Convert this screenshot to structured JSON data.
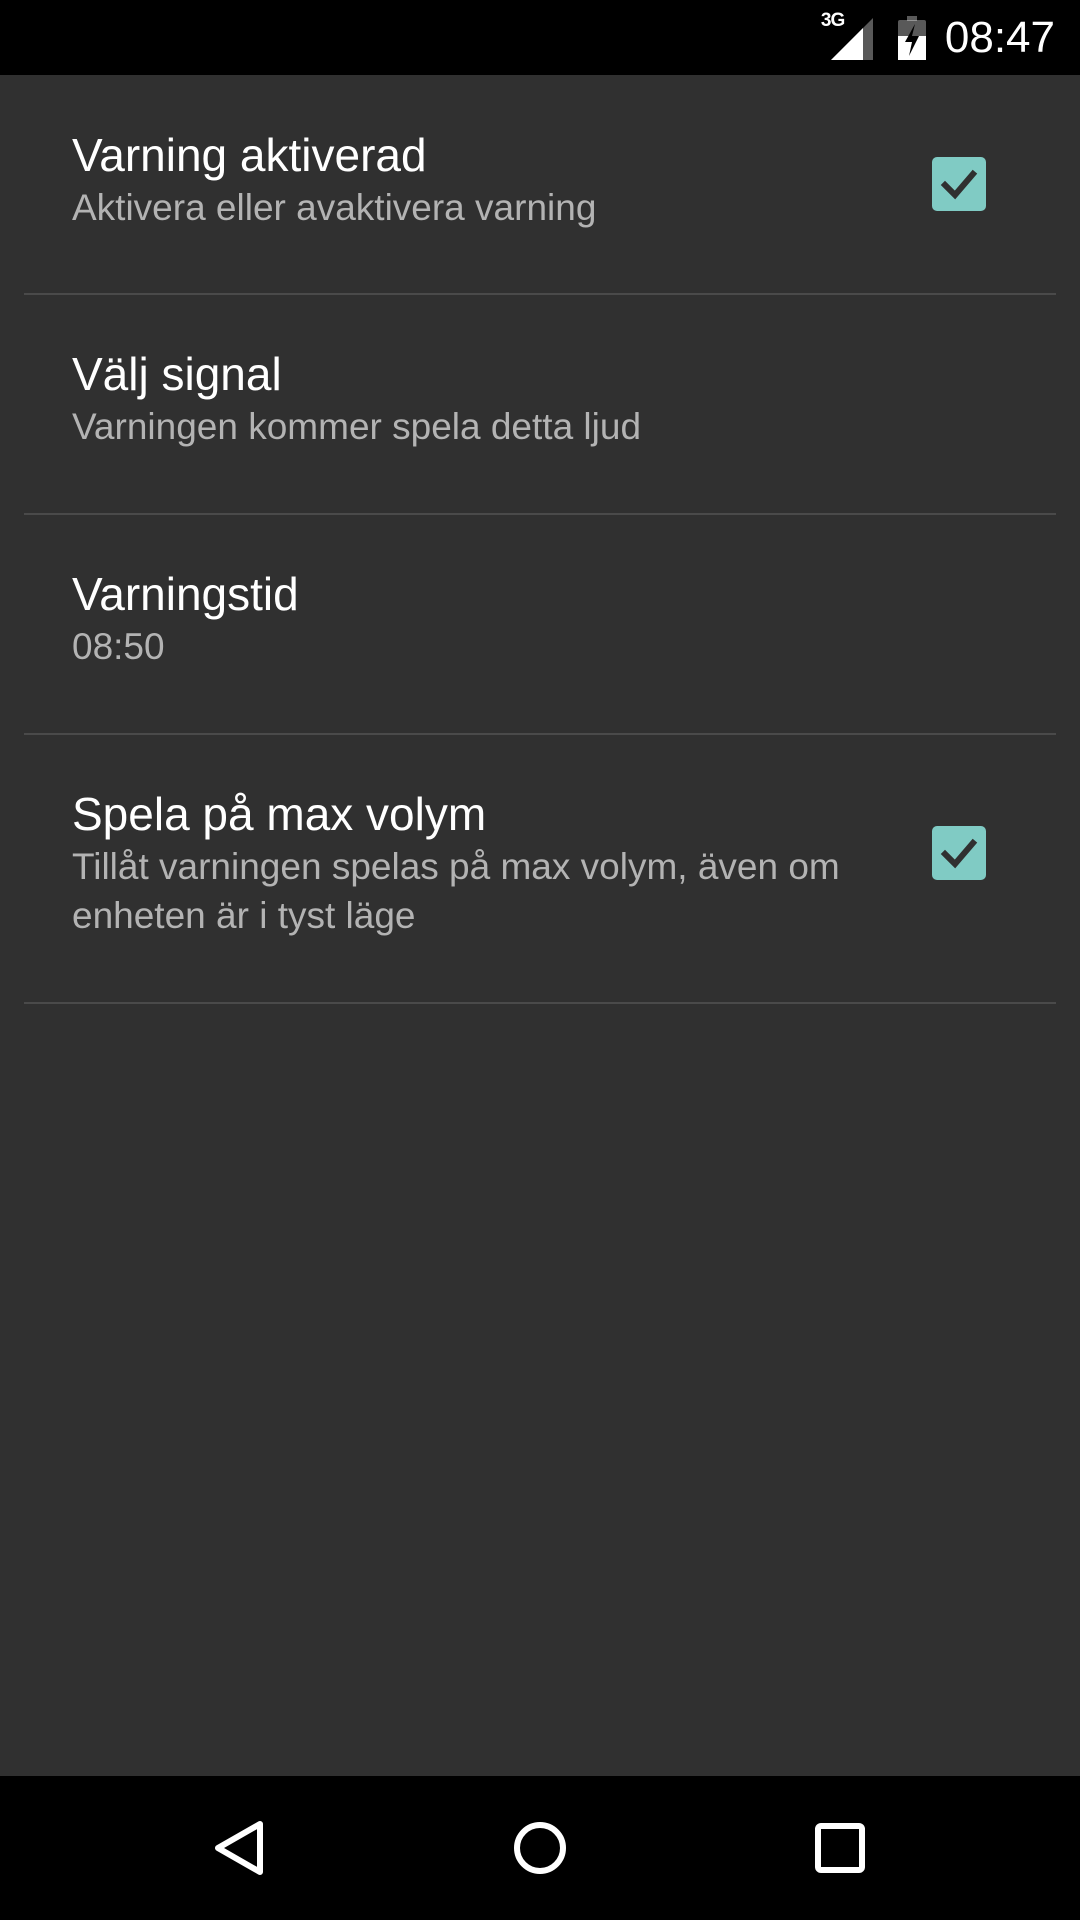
{
  "status_bar": {
    "network_label": "3G",
    "time": "08:47",
    "icons": [
      "signal-3g-icon",
      "battery-charging-icon"
    ]
  },
  "preferences": [
    {
      "title": "Varning aktiverad",
      "summary": "Aktivera eller avaktivera varning",
      "has_checkbox": true,
      "checked": true
    },
    {
      "title": "Välj signal",
      "summary": "Varningen kommer spela detta ljud",
      "has_checkbox": false
    },
    {
      "title": "Varningstid",
      "summary": "08:50",
      "has_checkbox": false
    },
    {
      "title": "Spela på max volym",
      "summary": "Tillåt varningen spelas på max volym, även om enheten är i tyst läge",
      "has_checkbox": true,
      "checked": true
    }
  ],
  "nav_bar": {
    "buttons": [
      "back-icon",
      "home-icon",
      "recents-icon"
    ]
  },
  "colors": {
    "background": "#303030",
    "accent": "#80cbc4",
    "title_text": "#ffffff",
    "summary_text": "#b3b3b3",
    "bars": "#000000"
  }
}
